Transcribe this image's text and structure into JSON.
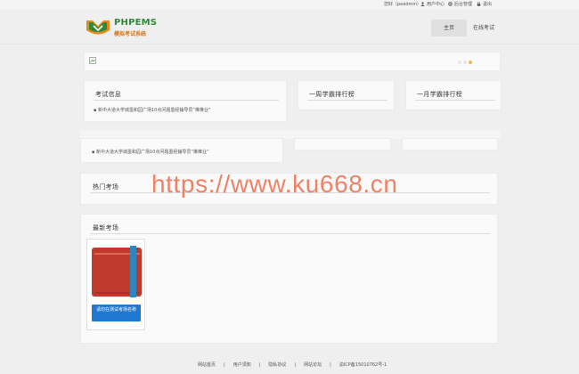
{
  "topbar": {
    "greeting": "您好（peadmin）",
    "user_center": "用户中心",
    "admin": "后台管理",
    "logout": "退出"
  },
  "header": {
    "logo_text": "PHPEMS",
    "logo_subtitle": "模拟考试系统",
    "nav": [
      {
        "label": "主页",
        "active": true
      },
      {
        "label": "在线考试",
        "active": false
      }
    ]
  },
  "banner": {
    "dots": 3
  },
  "exam_info": {
    "title": "考试信息",
    "items": [
      "新中大道大学城墨和园广场10点问题墨经辅导员“推推业”"
    ]
  },
  "week_rank": {
    "title": "一周学霸排行榜"
  },
  "month_rank": {
    "title": "一月学霸排行榜"
  },
  "exam_info_dup": {
    "items": [
      "新中大道大学城墨和园广场10点问题墨经辅导员“推推业”"
    ]
  },
  "hot_exams": {
    "title": "热门考场"
  },
  "new_exams": {
    "title": "最新考场",
    "cards": [
      {
        "button_label": "请勿在测试考场名称"
      }
    ]
  },
  "watermark": "https://www.ku668.cn",
  "footer": {
    "links": [
      "网站首页",
      "用户须知",
      "隐私协议",
      "网站论坛",
      "渝ICP备15010762号-1"
    ],
    "separator": "|"
  },
  "colors": {
    "accent_blue": "#1f78d1",
    "book_red": "#c0392b",
    "book_strap": "#2e86c1",
    "watermark": "#ee5f3c"
  }
}
